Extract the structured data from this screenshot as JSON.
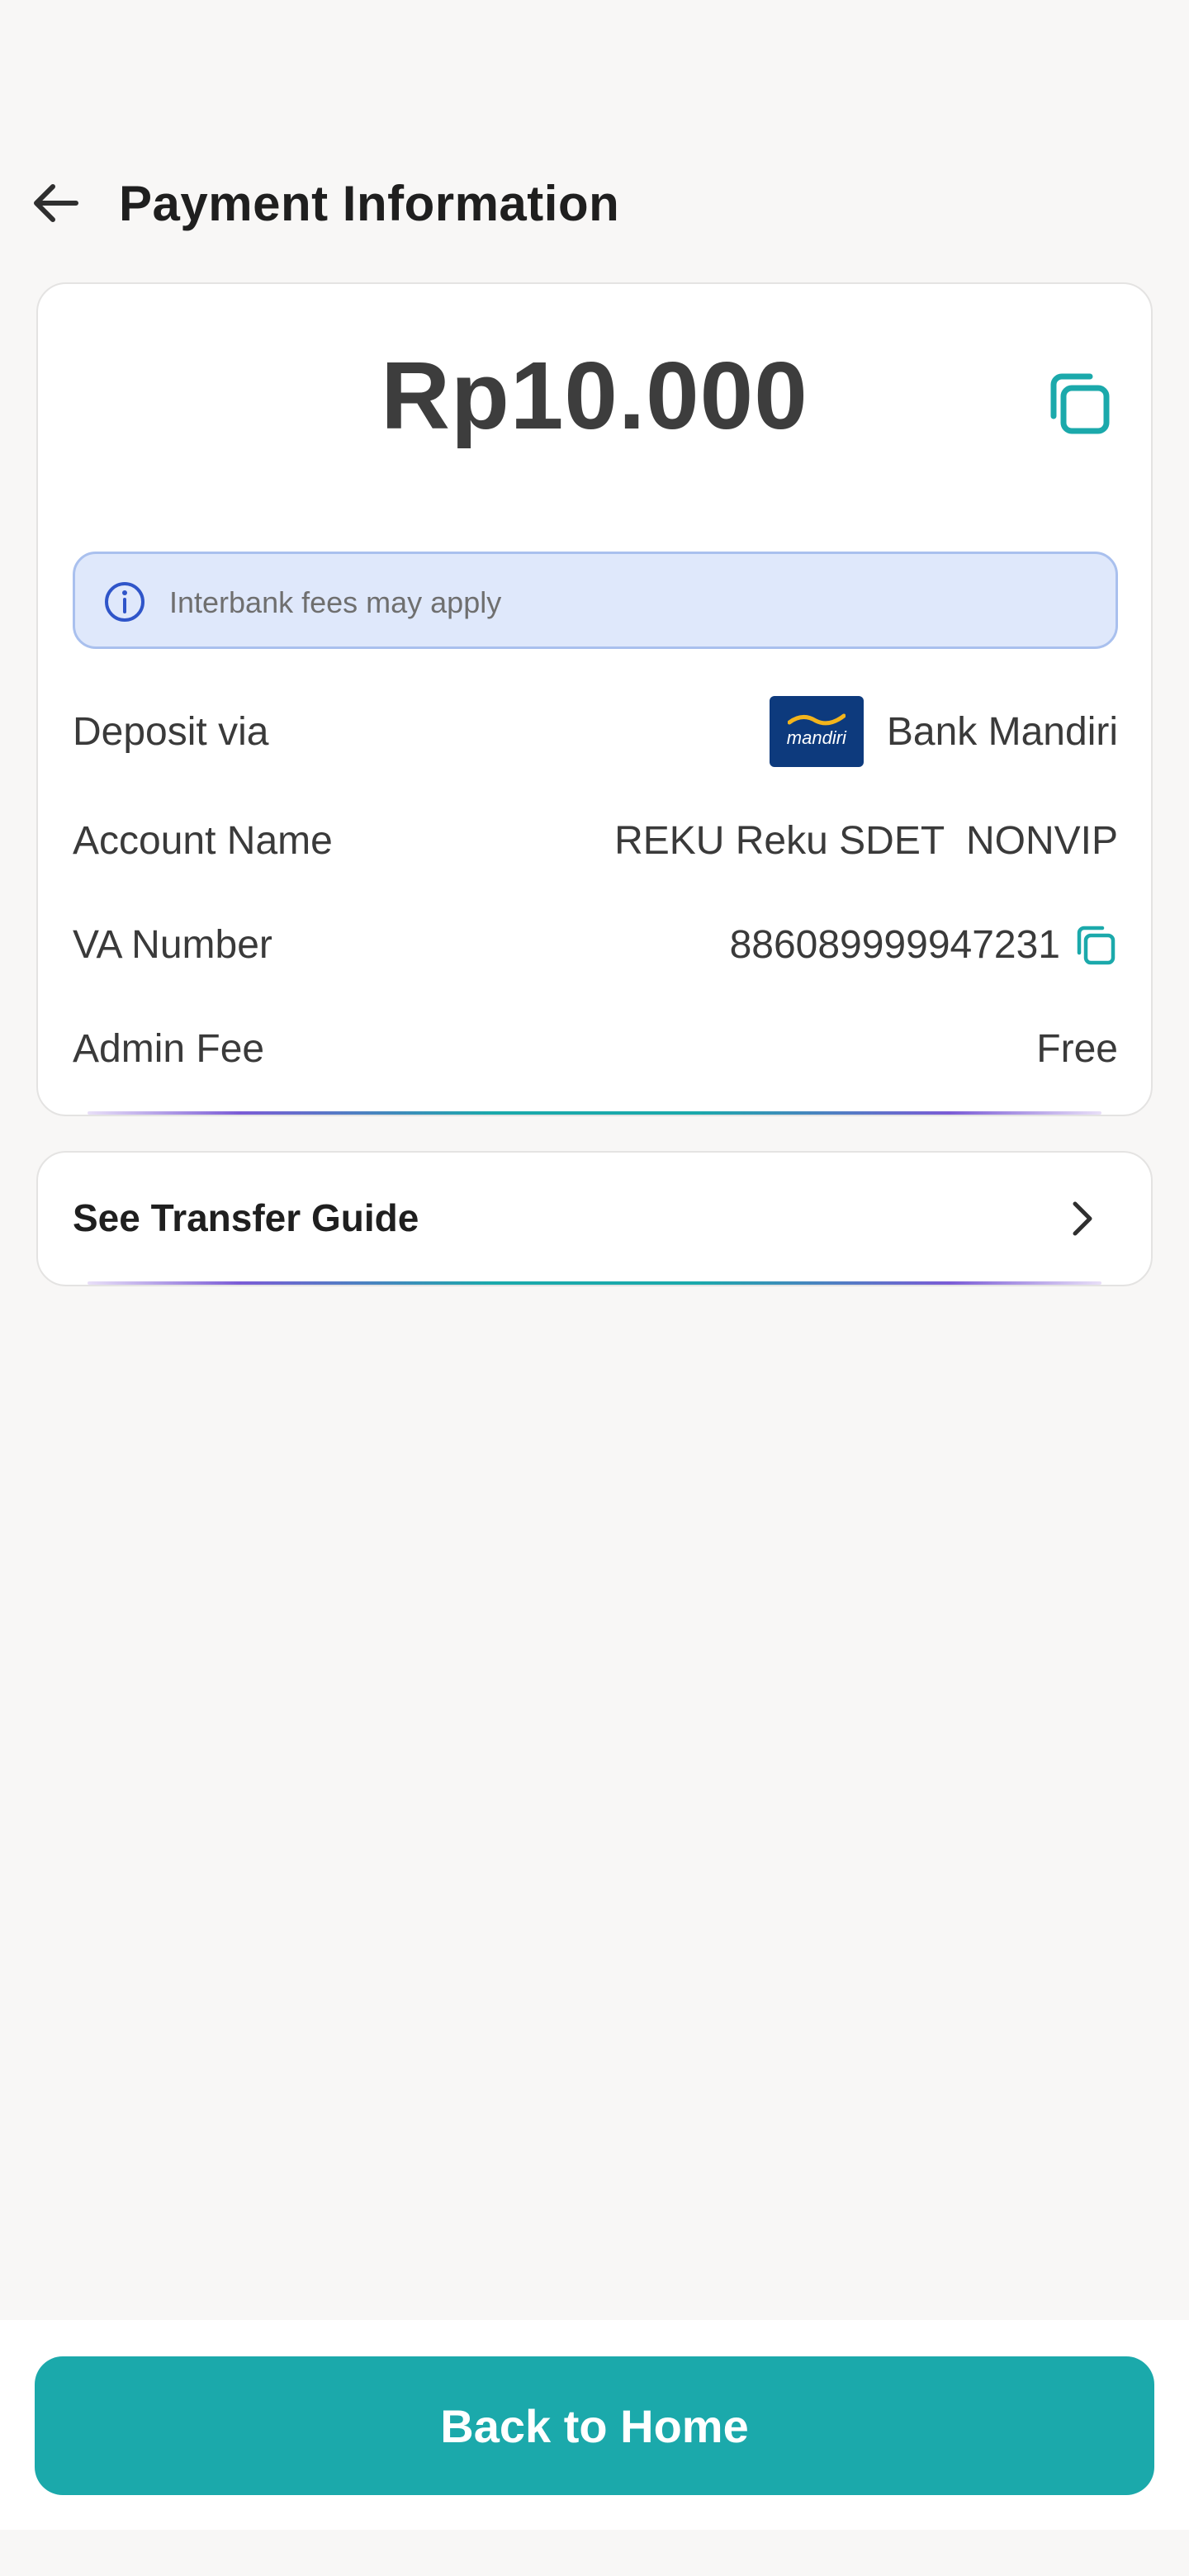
{
  "header": {
    "title": "Payment Information",
    "back_icon": "arrow-left-icon"
  },
  "payment": {
    "amount": "Rp10.000",
    "copy_icon": "copy-icon",
    "notice": "Interbank fees may apply",
    "notice_icon": "info-circle-icon",
    "rows": {
      "deposit_via": {
        "label": "Deposit via",
        "value": "Bank Mandiri",
        "logo_text": "mandiri"
      },
      "account_name": {
        "label": "Account Name",
        "value": "REKU Reku SDET  NONVIP"
      },
      "va_number": {
        "label": "VA Number",
        "value": "886089999947231"
      },
      "admin_fee": {
        "label": "Admin Fee",
        "value": "Free"
      }
    }
  },
  "guide": {
    "label": "See Transfer Guide",
    "chevron_icon": "chevron-right-icon"
  },
  "footer": {
    "button_label": "Back to Home"
  },
  "colors": {
    "accent": "#1ba9ab",
    "info_bg": "#dfe8fb",
    "info_border": "#a9c0ee",
    "bank_blue": "#0d3a7d",
    "background": "#f8f7f6"
  }
}
